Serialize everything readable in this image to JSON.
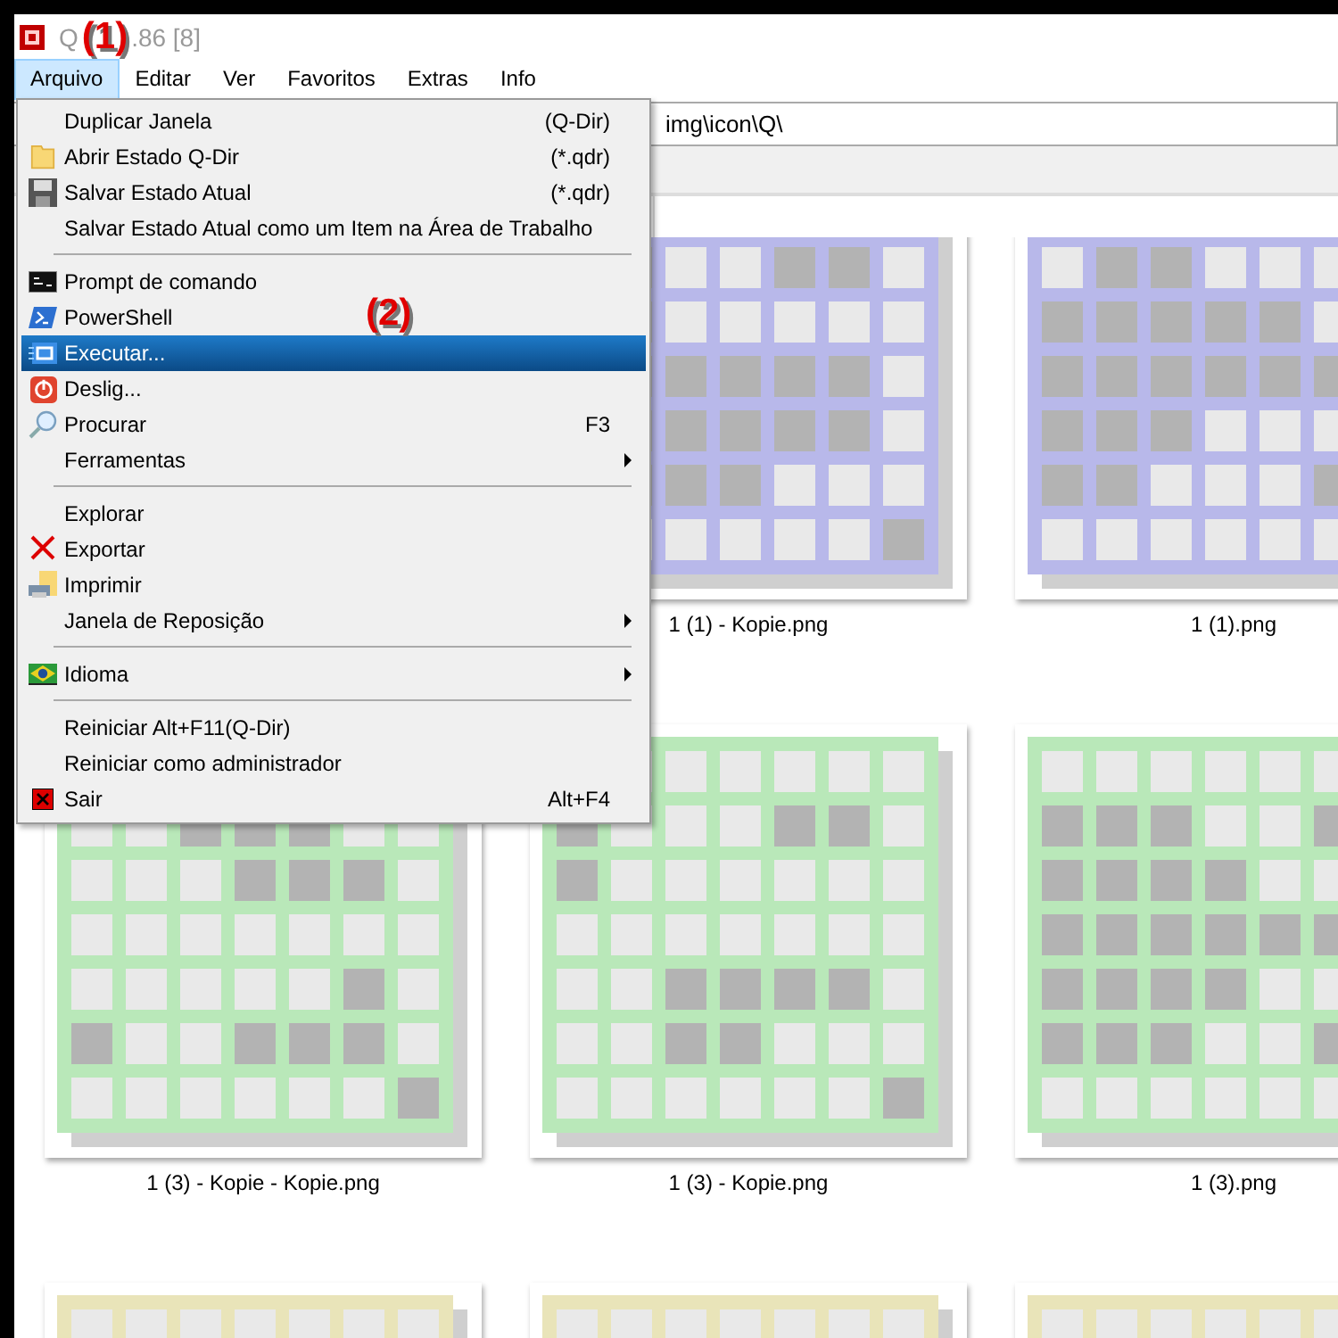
{
  "window": {
    "title_start": "Q",
    "title_end": ".86 [8]"
  },
  "annotations": [
    "(1)",
    "(2)"
  ],
  "menu_bar": [
    {
      "label": "Arquivo",
      "selected": true
    },
    {
      "label": "Editar",
      "selected": false
    },
    {
      "label": "Ver",
      "selected": false
    },
    {
      "label": "Favoritos",
      "selected": false
    },
    {
      "label": "Extras",
      "selected": false
    },
    {
      "label": "Info",
      "selected": false
    }
  ],
  "address_bar": {
    "value": "img\\icon\\Q\\"
  },
  "menu": [
    {
      "kind": "item",
      "label": "Duplicar Janela",
      "shortcut": "(Q-Dir)",
      "submenu": false,
      "selected": false
    },
    {
      "kind": "item",
      "label": "Abrir Estado Q-Dir",
      "shortcut": "(*.qdr)",
      "submenu": false,
      "selected": false
    },
    {
      "kind": "item",
      "label": "Salvar Estado Atual",
      "shortcut": "(*.qdr)",
      "submenu": false,
      "selected": false
    },
    {
      "kind": "item",
      "label": "Salvar Estado Atual como um Item na Área de Trabalho",
      "submenu": false,
      "selected": false
    },
    {
      "kind": "separator"
    },
    {
      "kind": "item",
      "label": "Prompt de comando",
      "submenu": false,
      "selected": false
    },
    {
      "kind": "item",
      "label": "PowerShell",
      "submenu": false,
      "selected": false
    },
    {
      "kind": "item",
      "label": "Executar...",
      "submenu": false,
      "selected": true
    },
    {
      "kind": "item",
      "label": "Deslig...",
      "submenu": false,
      "selected": false
    },
    {
      "kind": "item",
      "label": "Procurar",
      "shortcut": "F3",
      "submenu": false,
      "selected": false
    },
    {
      "kind": "item",
      "label": "Ferramentas",
      "submenu": true,
      "selected": false
    },
    {
      "kind": "separator"
    },
    {
      "kind": "item",
      "label": "Explorar",
      "submenu": false,
      "selected": false
    },
    {
      "kind": "item",
      "label": "Exportar",
      "submenu": false,
      "selected": false
    },
    {
      "kind": "item",
      "label": "Imprimir",
      "submenu": false,
      "selected": false
    },
    {
      "kind": "item",
      "label": "Janela de Reposição",
      "submenu": true,
      "selected": false
    },
    {
      "kind": "separator"
    },
    {
      "kind": "item",
      "label": "Idioma",
      "submenu": true,
      "selected": false
    },
    {
      "kind": "separator"
    },
    {
      "kind": "item",
      "label": "Reiniciar Alt+F11(Q-Dir)",
      "submenu": false,
      "selected": false
    },
    {
      "kind": "item",
      "label": "Reiniciar como administrador",
      "submenu": false,
      "selected": false
    },
    {
      "kind": "item",
      "label": "Sair",
      "shortcut": "Alt+F4",
      "submenu": false,
      "selected": false
    }
  ],
  "files": [
    {
      "kind": "covered"
    },
    {
      "kind": "picture",
      "name": "1 (1) - Kopie.png"
    },
    {
      "kind": "picture",
      "name": "1 (1).png"
    },
    {
      "kind": "picture",
      "name": "1 (3) - Kopie - Kopie.png"
    },
    {
      "kind": "picture",
      "name": "1 (3) - Kopie.png"
    },
    {
      "kind": "picture",
      "name": "1 (3).png"
    },
    {
      "kind": "picture"
    },
    {
      "kind": "picture"
    },
    {
      "kind": "picture"
    }
  ]
}
